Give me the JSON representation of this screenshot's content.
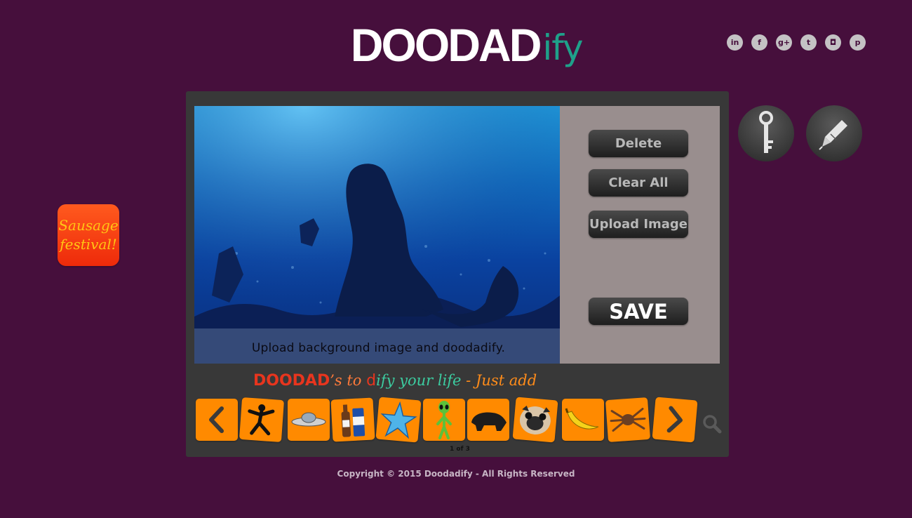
{
  "header": {
    "logo_main": "DOODAD",
    "logo_suffix": "ify",
    "social": [
      {
        "name": "linkedin-icon",
        "glyph": "in"
      },
      {
        "name": "facebook-icon",
        "glyph": "f"
      },
      {
        "name": "google-plus-icon",
        "glyph": "g+"
      },
      {
        "name": "twitter-icon",
        "glyph": "t"
      },
      {
        "name": "instagram-icon",
        "glyph": "◘"
      },
      {
        "name": "pinterest-icon",
        "glyph": "p"
      }
    ]
  },
  "side_badge": {
    "line1": "Sausage",
    "line2": "festival!"
  },
  "editor": {
    "caption": "Upload background image and doodadify.",
    "buttons": {
      "delete": "Delete",
      "clear_all": "Clear All",
      "upload_image": "Upload Image",
      "save": "SAVE"
    }
  },
  "tools": [
    {
      "name": "key-icon"
    },
    {
      "name": "pen-nib-icon"
    }
  ],
  "tagline": {
    "part1": "DOODAD",
    "part2": "’s to ",
    "part3": "d",
    "part4": "ify your life",
    "part5": " - Just add"
  },
  "carousel": {
    "items": [
      {
        "name": "ninja-doodad"
      },
      {
        "name": "ufo-doodad"
      },
      {
        "name": "beer-doodad"
      },
      {
        "name": "star-doodad"
      },
      {
        "name": "alien-doodad"
      },
      {
        "name": "bear-doodad"
      },
      {
        "name": "pug-doodad"
      },
      {
        "name": "banana-doodad"
      },
      {
        "name": "spider-doodad"
      }
    ],
    "page_indicator": "1 of 3"
  },
  "footer": {
    "copyright": "Copyright © 2015 Doodadify - All Rights Reserved"
  },
  "colors": {
    "background": "#460f3c",
    "panel": "#383838",
    "controls_bg": "#998e8e",
    "tile": "#ff8a00",
    "logo_accent": "#1fa08a",
    "badge": "#f03a0f"
  }
}
